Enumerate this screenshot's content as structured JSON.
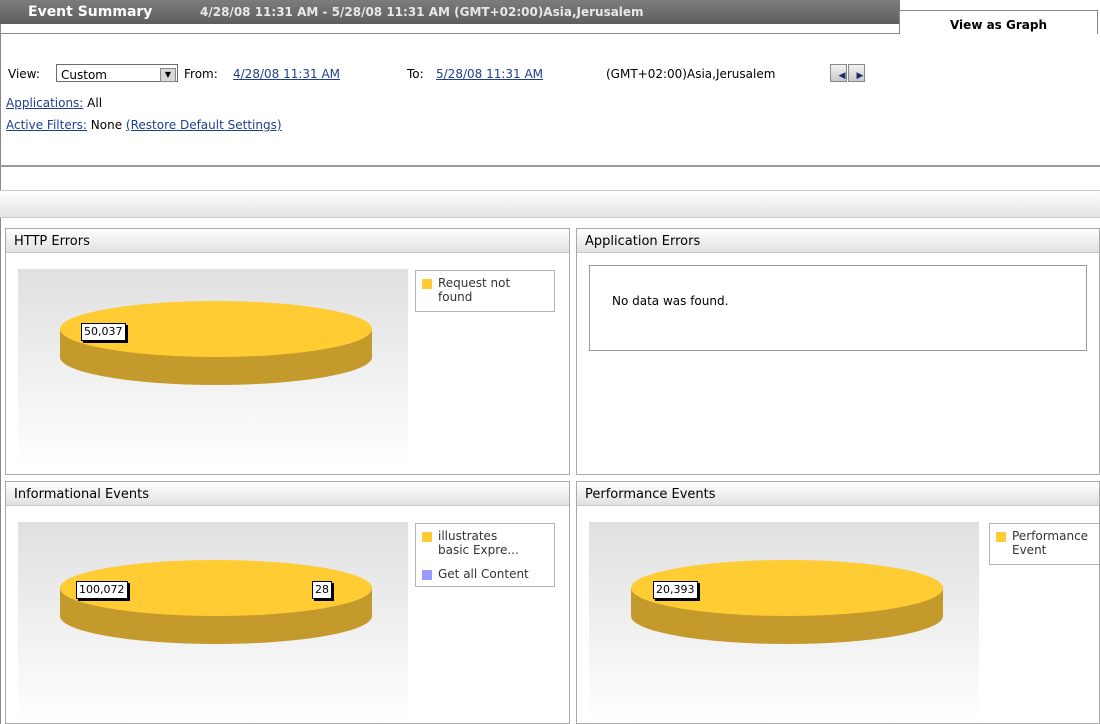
{
  "header": {
    "title": "Event Summary",
    "range": "4/28/08 11:31 AM - 5/28/08 11:31 AM (GMT+02:00)Asia,Jerusalem",
    "tab_label": "View as Graph"
  },
  "filters": {
    "view_label": "View:",
    "view_value": "Custom",
    "from_label": "From:",
    "from_value": "4/28/08 11:31 AM",
    "to_label": "To:",
    "to_value": "5/28/08 11:31 AM",
    "timezone": "(GMT+02:00)Asia,Jerusalem",
    "applications_label": "Applications:",
    "applications_value": "All",
    "active_filters_label": "Active Filters:",
    "active_filters_value": "None",
    "restore_link": "(Restore Default Settings)"
  },
  "panels": {
    "http_errors": {
      "title": "HTTP Errors"
    },
    "application_errors": {
      "title": "Application Errors",
      "message": "No data was found."
    },
    "informational_events": {
      "title": "Informational Events"
    },
    "performance_events": {
      "title": "Performance Events"
    }
  },
  "colors": {
    "yellow": "#FFCC33",
    "yellow_side": "#C49A2C",
    "purple": "#9999FF"
  },
  "chart_data": [
    {
      "type": "pie",
      "title": "HTTP Errors",
      "slices": [
        {
          "label": "Request not found",
          "value": 50037,
          "display": "50,037"
        }
      ],
      "legend": [
        "Request not found"
      ]
    },
    {
      "type": "pie",
      "title": "Informational Events",
      "slices": [
        {
          "label": "illustrates basic Expre...",
          "value": 100072,
          "display": "100,072"
        },
        {
          "label": "Get all Content",
          "value": 28,
          "display": "28"
        }
      ],
      "legend": [
        "illustrates basic Expre...",
        "Get all Content"
      ]
    },
    {
      "type": "pie",
      "title": "Performance Events",
      "slices": [
        {
          "label": "Performance Event",
          "value": 20393,
          "display": "20,393"
        }
      ],
      "legend": [
        "Performance Event"
      ]
    }
  ],
  "legends": {
    "http_1_line1": "Request not",
    "http_1_line2": "found",
    "info_1_line1": "illustrates",
    "info_1_line2": "basic Expre...",
    "info_2": "Get all Content",
    "perf_1_line1": "Performance",
    "perf_1_line2": "Event"
  }
}
